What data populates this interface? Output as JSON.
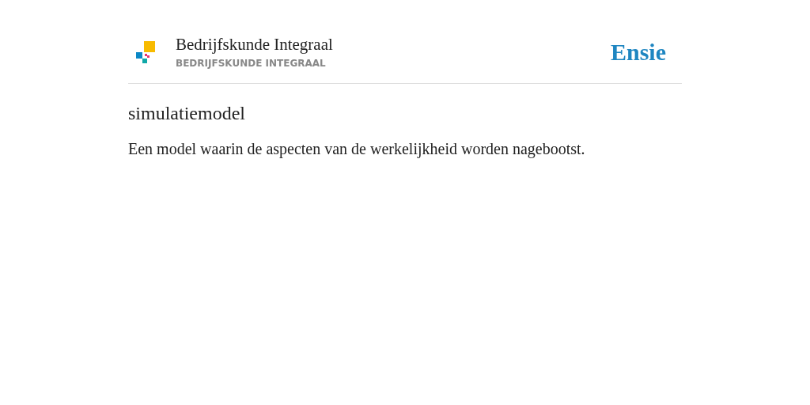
{
  "header": {
    "title": "Bedrijfskunde Integraal",
    "subtitle": "BEDRIJFSKUNDE INTEGRAAL",
    "brand": "Ensie"
  },
  "entry": {
    "term": "simulatiemodel",
    "definition": "Een model waarin de aspecten van de werkelijkheid worden nagebootst."
  }
}
